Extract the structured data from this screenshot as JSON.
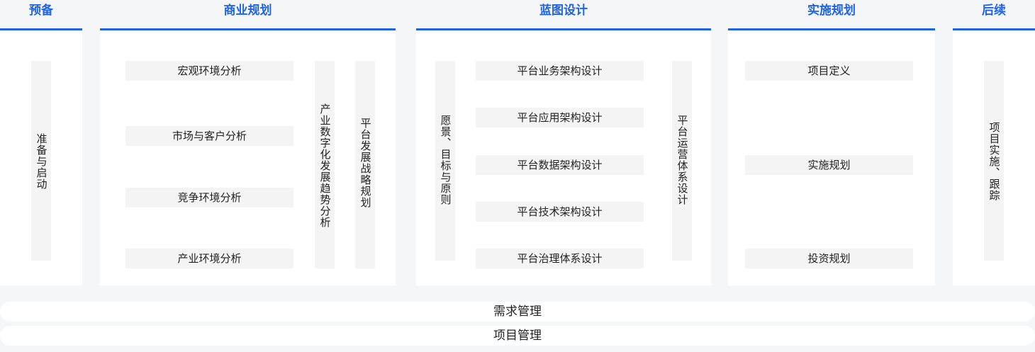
{
  "phases": [
    {
      "title": "预备"
    },
    {
      "title": "商业规划"
    },
    {
      "title": "蓝图设计"
    },
    {
      "title": "实施规划"
    },
    {
      "title": "后续"
    }
  ],
  "prep": {
    "vertical": "准备与启动"
  },
  "business": {
    "items": [
      "宏观环境分析",
      "市场与客户分析",
      "竞争环境分析",
      "产业环境分析"
    ],
    "vertical_a": "产业数字化发展趋势分析",
    "vertical_b": "平台发展战略规划"
  },
  "blueprint": {
    "vertical_left": "愿景、目标与原则",
    "items": [
      "平台业务架构设计",
      "平台应用架构设计",
      "平台数据架构设计",
      "平台技术架构设计",
      "平台治理体系设计"
    ],
    "vertical_right": "平台运营体系设计"
  },
  "implementation": {
    "items": [
      "项目定义",
      "实施规划",
      "投资规划"
    ]
  },
  "followup": {
    "vertical": "项目实施、跟踪"
  },
  "bars": [
    "需求管理",
    "项目管理"
  ]
}
